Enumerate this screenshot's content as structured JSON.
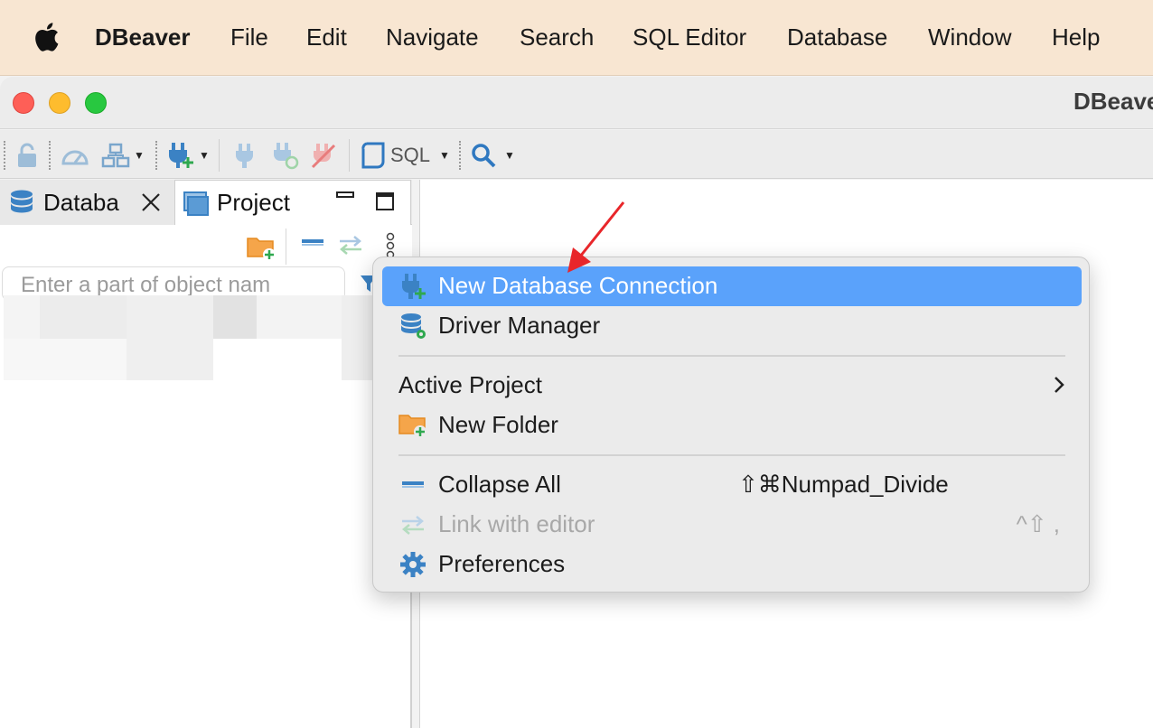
{
  "menubar": {
    "app_name": "DBeaver",
    "items": [
      "File",
      "Edit",
      "Navigate",
      "Search",
      "SQL Editor",
      "Database",
      "Window",
      "Help"
    ]
  },
  "window": {
    "title": "DBeave"
  },
  "toolbar": {
    "sql_label": "SQL"
  },
  "left_panel": {
    "tabs": [
      {
        "label": "Databa",
        "icon": "database-icon"
      },
      {
        "label": "Project",
        "icon": "project-window-icon"
      }
    ],
    "filter_placeholder": "Enter a part of object nam"
  },
  "context_menu": {
    "items": [
      {
        "label": "New Database Connection",
        "icon": "plug-add-icon",
        "selected": true
      },
      {
        "label": "Driver Manager",
        "icon": "database-gear-icon"
      },
      {
        "label": "Active Project",
        "submenu": true
      },
      {
        "label": "New Folder",
        "icon": "folder-add-icon"
      },
      {
        "label": "Collapse All",
        "icon": "collapse-icon",
        "shortcut": "⇧⌘Numpad_Divide"
      },
      {
        "label": "Link with editor",
        "icon": "link-arrows-icon",
        "shortcut": "^⇧ ,",
        "disabled": true
      },
      {
        "label": "Preferences",
        "icon": "gear-icon"
      }
    ]
  },
  "colors": {
    "menubar": "#f8e6d2",
    "selection": "#5aa2fb",
    "annotation_arrow": "#e8262a"
  }
}
